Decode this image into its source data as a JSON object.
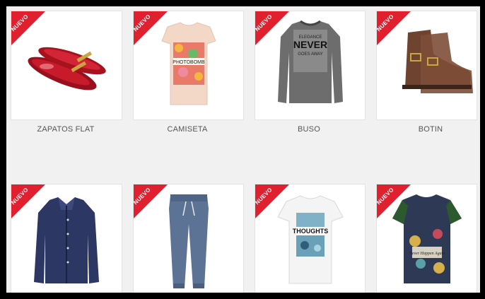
{
  "badge_text": "NUEVO",
  "badge_color": "#e0202f",
  "products": [
    {
      "name": "ZAPATOS FLAT",
      "image": "red-loafers-image"
    },
    {
      "name": "CAMISETA",
      "image": "floral-tshirt-image",
      "print_text": "PHOTOBOMB"
    },
    {
      "name": "BUSO",
      "image": "grey-sweatshirt-image",
      "print_text": [
        "ELEGANCE",
        "NEVER",
        "GOES AWAY"
      ]
    },
    {
      "name": "BOTIN",
      "image": "brown-ankle-boot-image"
    },
    {
      "name": "",
      "image": "navy-blouse-image"
    },
    {
      "name": "",
      "image": "blue-joggers-image"
    },
    {
      "name": "",
      "image": "white-graphic-tee-image",
      "print_text": "THOUGHTS"
    },
    {
      "name": "",
      "image": "floral-print-tee-image",
      "print_text": "Never Happen Again"
    }
  ]
}
